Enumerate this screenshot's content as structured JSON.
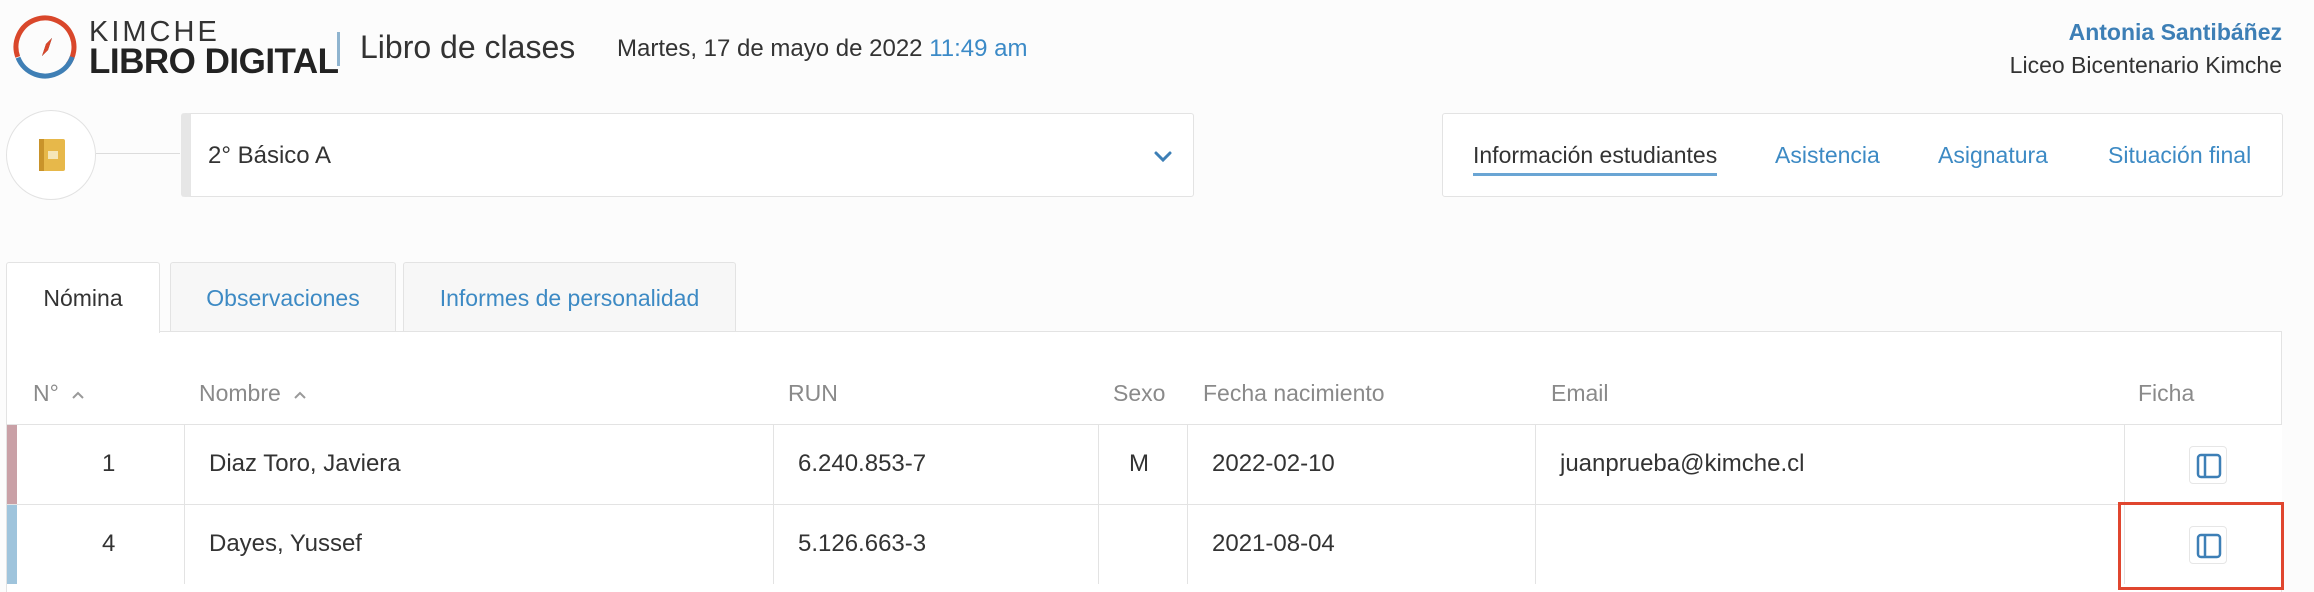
{
  "brand": {
    "top": "KIMCHE",
    "bottom": "LIBRO DIGITAL"
  },
  "header": {
    "title": "Libro de clases",
    "date": "Martes, 17 de mayo de 2022",
    "time": "11:49 am",
    "user_name": "Antonia Santibáñez",
    "school": "Liceo Bicentenario Kimche"
  },
  "course": {
    "selected": "2° Básico A",
    "icon": "book-icon"
  },
  "nav": [
    {
      "label": "Información estudiantes",
      "active": true
    },
    {
      "label": "Asistencia"
    },
    {
      "label": "Asignatura"
    },
    {
      "label": "Situación final"
    }
  ],
  "tabs": [
    {
      "label": "Nómina",
      "active": true
    },
    {
      "label": "Observaciones"
    },
    {
      "label": "Informes de personalidad"
    }
  ],
  "table": {
    "headers": {
      "num": "N°",
      "name": "Nombre",
      "run": "RUN",
      "sex": "Sexo",
      "birth": "Fecha nacimiento",
      "email": "Email",
      "ficha": "Ficha"
    },
    "rows": [
      {
        "num": "1",
        "name": "Diaz Toro, Javiera",
        "run": "6.240.853-7",
        "sex": "M",
        "birth": "2022-02-10",
        "email": "juanprueba@kimche.cl",
        "stripe_color": "#c9a0a6"
      },
      {
        "num": "4",
        "name": "Dayes, Yussef",
        "run": "5.126.663-3",
        "sex": "",
        "birth": "2021-08-04",
        "email": "",
        "stripe_color": "#9fc4dc"
      }
    ]
  },
  "colors": {
    "accent": "#3d8ac4",
    "highlight": "#e0462f"
  }
}
